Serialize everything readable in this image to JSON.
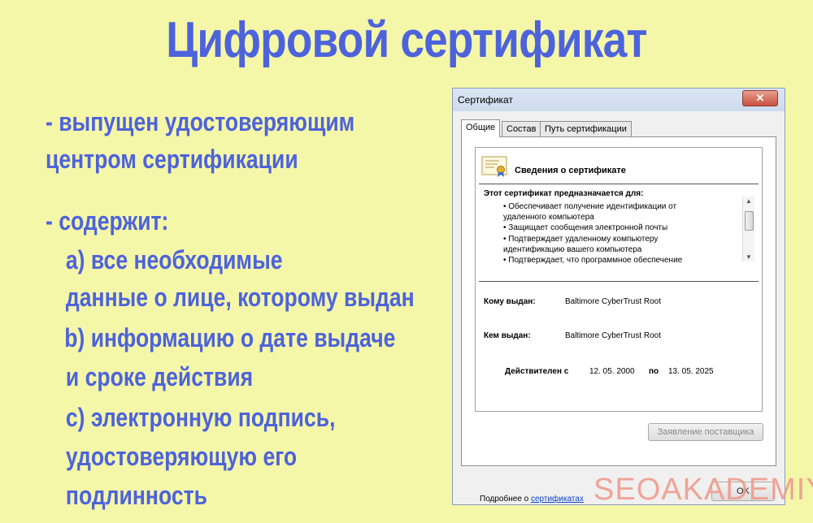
{
  "title": "Цифровой сертификат",
  "bullets": {
    "b1_line1": "- выпущен удостоверяющим",
    "b1_line2": "центром сертификации",
    "b2_head": "- содержит:",
    "a_line1": "a) все необходимые",
    "a_line2": "данные о лице, которому выдан",
    "b_line1": "b) информацию о дате выдаче",
    "b_line2": "и сроке действия",
    "c_line1": "c) электронную подпись,",
    "c_line2": "удостоверяющую его",
    "c_line3": "подлинность"
  },
  "dialog": {
    "title": "Сертификат",
    "close_label": "✕",
    "tabs": [
      "Общие",
      "Состав",
      "Путь сертификации"
    ],
    "header": "Сведения о сертификате",
    "purpose_label": "Этот сертификат предназначается для:",
    "purposes": [
      "• Обеспечивает получение идентификации от",
      "удаленного компьютера",
      "• Защищает сообщения электронной почты",
      "• Подтверждает удаленному компьютеру",
      "идентификацию вашего компьютера",
      "• Подтверждает, что программное обеспечение"
    ],
    "issued_to_label": "Кому выдан:",
    "issued_to": "Baltimore CyberTrust Root",
    "issued_by_label": "Кем выдан:",
    "issued_by": "Baltimore CyberTrust Root",
    "valid_from_label": "Действителен с",
    "valid_from": "12. 05. 2000",
    "valid_to_label": "по",
    "valid_to": "13. 05. 2025",
    "issuer_statement_button": "Заявление поставщика",
    "more_prefix": "Подробнее о",
    "more_link": "сертификатах",
    "ok_button": "OK"
  },
  "watermark": "SEOAKADEMIYA",
  "colors": {
    "background": "#f5f7a8",
    "accent": "#4d63dc",
    "link": "#0b44c8"
  }
}
